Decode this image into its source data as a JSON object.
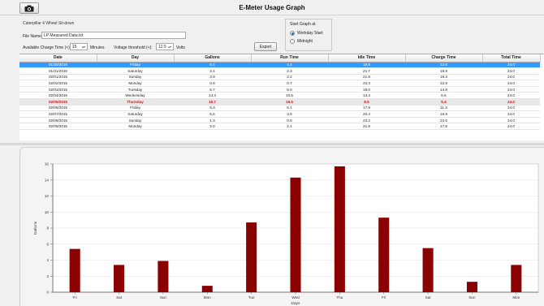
{
  "header": {
    "title": "E-Meter Usage Graph",
    "camera_icon": "camera-icon"
  },
  "controls": {
    "device_name": "Caterpillar 4 Wheel Sit-down",
    "file_label": "File Name:",
    "file_value": "LP Measured Data.txt",
    "charge_label": "Available Charge Time (<):",
    "charge_value": "15",
    "charge_unit": "Minutes",
    "volt_label": "Voltage threshold (<):",
    "volt_value": "12.5",
    "volt_unit": "Volts",
    "export_label": "Export"
  },
  "start_graph": {
    "title": "Start Graph at",
    "options": [
      "Workday Start",
      "Midnight"
    ],
    "selected": "Workday Start"
  },
  "table": {
    "columns": [
      "Date",
      "Day",
      "Gallons",
      "Run Time",
      "Idle Time",
      "Charge Time",
      "Total Time"
    ],
    "rows": [
      [
        "01/30/2015",
        "Friday",
        "5.4",
        "4.4",
        "19.6",
        "12.8",
        "24.0"
      ],
      [
        "01/31/2015",
        "Saturday",
        "3.4",
        "2.3",
        "21.7",
        "18.9",
        "24.0"
      ],
      [
        "02/01/2015",
        "Sunday",
        "3.9",
        "2.2",
        "21.8",
        "19.3",
        "24.0"
      ],
      [
        "02/02/2015",
        "Monday",
        "0.8",
        "0.7",
        "23.3",
        "22.8",
        "24.0"
      ],
      [
        "02/03/2015",
        "Tuesday",
        "8.7",
        "6.0",
        "18.0",
        "14.8",
        "24.0"
      ],
      [
        "02/04/2015",
        "Wednesday",
        "14.3",
        "10.6",
        "13.4",
        "6.6",
        "24.0"
      ],
      [
        "02/05/2015",
        "Thursday",
        "15.7",
        "15.5",
        "8.5",
        "5.4",
        "24.0"
      ],
      [
        "02/06/2015",
        "Friday",
        "9.3",
        "6.1",
        "17.9",
        "11.3",
        "24.0"
      ],
      [
        "02/07/2015",
        "Saturday",
        "5.5",
        "3.6",
        "20.4",
        "16.9",
        "24.0"
      ],
      [
        "02/08/2015",
        "Sunday",
        "1.3",
        "0.8",
        "23.2",
        "22.6",
        "24.0"
      ],
      [
        "02/09/2015",
        "Monday",
        "3.0",
        "2.1",
        "21.9",
        "17.6",
        "24.0"
      ]
    ],
    "selected_row": 0,
    "highlight_row": 6,
    "highlight_color": "#d01818",
    "selected_color": "#3399ff"
  },
  "chart_data": {
    "type": "bar",
    "categories": [
      "Fri",
      "Sat",
      "Sun",
      "Mon",
      "Tue",
      "Wed",
      "Thu",
      "Fri",
      "Sat",
      "Sun",
      "Mon"
    ],
    "values": [
      5.4,
      3.4,
      3.9,
      0.8,
      8.7,
      14.3,
      15.7,
      9.3,
      5.5,
      1.3,
      3.4
    ],
    "xlabel": "Days",
    "ylabel": "Gallons",
    "ylim": [
      0,
      16
    ],
    "yticks": [
      0,
      2,
      4,
      6,
      8,
      10,
      12,
      14,
      16
    ],
    "grid": true,
    "bar_color": "#8b0000"
  }
}
